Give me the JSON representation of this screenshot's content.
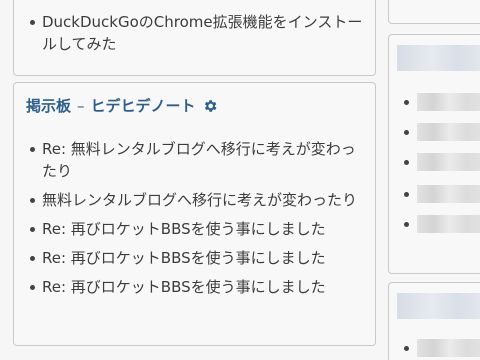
{
  "top_panel": {
    "items": [
      "DuckDuckGoのChrome拡張機能をインストールしてみた"
    ]
  },
  "board_panel": {
    "title_prefix": "掲示板",
    "title_separator": "–",
    "title_name": "ヒデヒデノート",
    "settings_icon": "gear-icon",
    "items": [
      "Re: 無料レンタルブログへ移行に考えが変わったり",
      "無料レンタルブログへ移行に考えが変わったり",
      "Re: 再びロケットBBSを使う事にしました",
      "Re: 再びロケットBBSを使う事にしました",
      "Re: 再びロケットBBSを使う事にしました"
    ]
  },
  "colors": {
    "title": "#2e5f8a",
    "text": "#3c3c3c",
    "panel_border": "#c9c9c9",
    "background": "#f6f6f6"
  }
}
